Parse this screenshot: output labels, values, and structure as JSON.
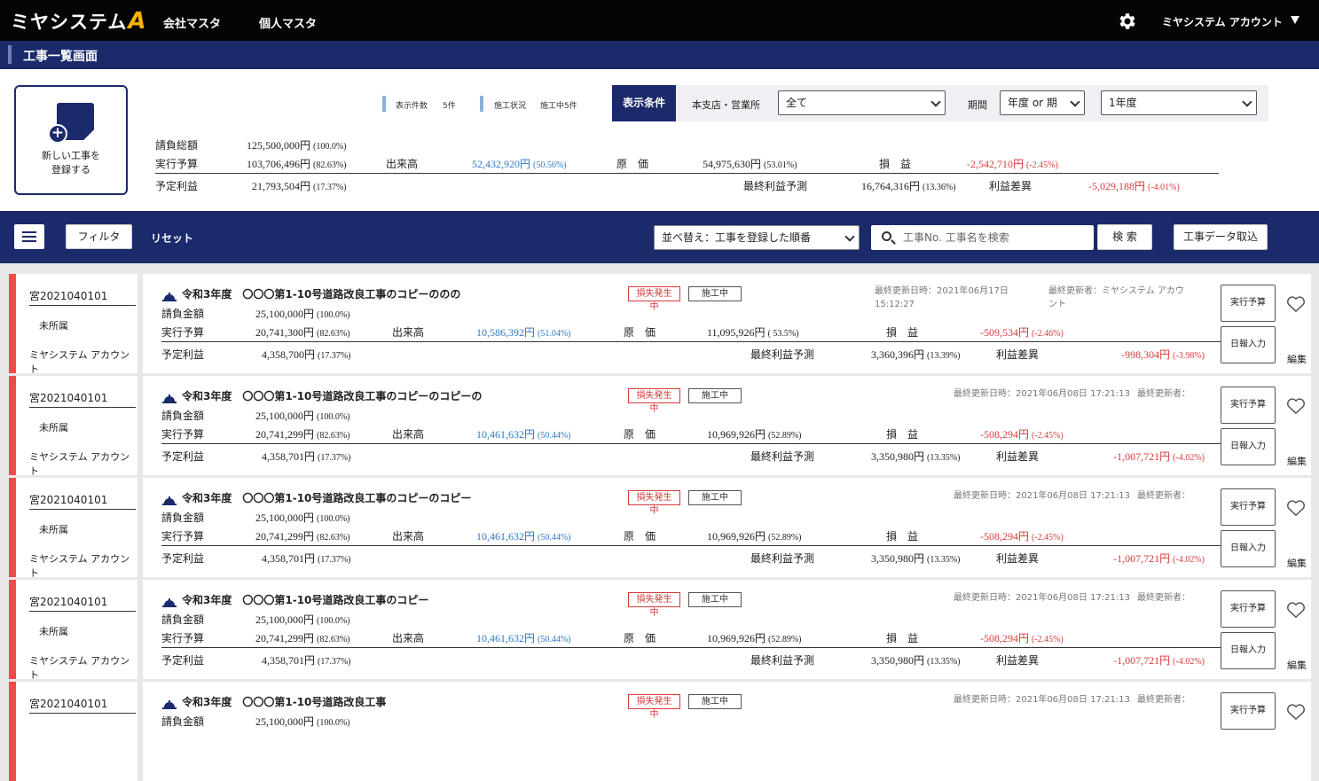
{
  "header": {
    "logo_text": "ミヤシステム",
    "logo_mark": "A",
    "nav": [
      "会社マスタ",
      "個人マスタ"
    ],
    "account": "ミヤシステム アカウント"
  },
  "page_title": "工事一覧画面",
  "new_button": {
    "line1": "新しい工事を",
    "line2": "登録する"
  },
  "stats": {
    "count_label": "表示件数",
    "count_value": "5件",
    "status_label": "施工状況",
    "status_value": "施工中5件"
  },
  "conditions": {
    "head": "表示条件",
    "branch_label": "本支店・営業所",
    "branch_value": "全て",
    "period_label": "期間",
    "period_type": "年度 or 期",
    "period_value": "1年度"
  },
  "summary": {
    "contract_label": "請負総額",
    "contract_value": "125,500,000円",
    "contract_pct": "(100.0%)",
    "budget_label": "実行予算",
    "budget_value": "103,706,496円",
    "budget_pct": "(82.63%)",
    "done_label": "出来高",
    "done_value": "52,432,920円",
    "done_pct": "(50.56%)",
    "cost_label": "原　価",
    "cost_value": "54,975,630円",
    "cost_pct": "(53.01%)",
    "pl_label": "損　益",
    "pl_value": "-2,542,710円",
    "pl_pct": "(-2.45%)",
    "profit_label": "予定利益",
    "profit_value": "21,793,504円",
    "profit_pct": "(17.37%)",
    "final_label": "最終利益予測",
    "final_value": "16,764,316円",
    "final_pct": "(13.36%)",
    "diff_label": "利益差異",
    "diff_value": "-5,029,188円",
    "diff_pct": "(-4.01%)"
  },
  "toolbar": {
    "filter": "フィルタ",
    "reset": "リセット",
    "sort": "並べ替え：工事を登録した順番",
    "search_placeholder": "工事No. 工事名を検索",
    "search_button": "検 索",
    "import_button": "工事データ取込"
  },
  "labels": {
    "contract": "請負金額",
    "budget": "実行予算",
    "done": "出来高",
    "cost": "原　価",
    "pl": "損　益",
    "profit": "予定利益",
    "final": "最終利益予測",
    "diff": "利益差異",
    "loss_badge": "損失発生中",
    "work_badge": "施工中",
    "budget_btn": "実行予算",
    "daily_btn": "日報入力",
    "edit": "編集"
  },
  "projects": [
    {
      "id": "宮2021040101",
      "dept": "未所属",
      "account": "ミヤシステム アカウント",
      "year": "令和3年度",
      "name": "〇〇〇第1-10号道路改良工事のコピーののの",
      "updated": "最終更新日時：2021年06月17日",
      "updated2": "15:12:27",
      "updater": "最終更新者：ミヤシステム アカウ",
      "updater2": "ント",
      "contract": "25,100,000円",
      "contract_pct": "(100.0%)",
      "budget": "20,741,300円",
      "budget_pct": "(82.63%)",
      "done": "10,586,392円",
      "done_pct": "(51.04%)",
      "cost": "11,095,926円",
      "cost_pct": "( 53.5%)",
      "pl": "-509,534円",
      "pl_pct": "(-2.46%)",
      "profit": "4,358,700円",
      "profit_pct": "(17.37%)",
      "final": "3,360,396円",
      "final_pct": "(13.39%)",
      "diff": "-998,304円",
      "diff_pct": "(-3.98%)"
    },
    {
      "id": "宮2021040101",
      "dept": "未所属",
      "account": "ミヤシステム アカウント",
      "year": "令和3年度",
      "name": "〇〇〇第1-10号道路改良工事のコピーのコピーの",
      "updated": "最終更新日時：2021年06月08日 17:21:13",
      "updated2": "",
      "updater": "最終更新者：",
      "updater2": "",
      "contract": "25,100,000円",
      "contract_pct": "(100.0%)",
      "budget": "20,741,299円",
      "budget_pct": "(82.63%)",
      "done": "10,461,632円",
      "done_pct": "(50.44%)",
      "cost": "10,969,926円",
      "cost_pct": "(52.89%)",
      "pl": "-508,294円",
      "pl_pct": "(-2.45%)",
      "profit": "4,358,701円",
      "profit_pct": "(17.37%)",
      "final": "3,350,980円",
      "final_pct": "(13.35%)",
      "diff": "-1,007,721円",
      "diff_pct": "(-4.02%)"
    },
    {
      "id": "宮2021040101",
      "dept": "未所属",
      "account": "ミヤシステム アカウント",
      "year": "令和3年度",
      "name": "〇〇〇第1-10号道路改良工事のコピーのコピー",
      "updated": "最終更新日時：2021年06月08日 17:21:13",
      "updated2": "",
      "updater": "最終更新者：",
      "updater2": "",
      "contract": "25,100,000円",
      "contract_pct": "(100.0%)",
      "budget": "20,741,299円",
      "budget_pct": "(82.63%)",
      "done": "10,461,632円",
      "done_pct": "(50.44%)",
      "cost": "10,969,926円",
      "cost_pct": "(52.89%)",
      "pl": "-508,294円",
      "pl_pct": "(-2.45%)",
      "profit": "4,358,701円",
      "profit_pct": "(17.37%)",
      "final": "3,350,980円",
      "final_pct": "(13.35%)",
      "diff": "-1,007,721円",
      "diff_pct": "(-4.02%)"
    },
    {
      "id": "宮2021040101",
      "dept": "未所属",
      "account": "ミヤシステム アカウント",
      "year": "令和3年度",
      "name": "〇〇〇第1-10号道路改良工事のコピー",
      "updated": "最終更新日時：2021年06月08日 17:21:13",
      "updated2": "",
      "updater": "最終更新者：",
      "updater2": "",
      "contract": "25,100,000円",
      "contract_pct": "(100.0%)",
      "budget": "20,741,299円",
      "budget_pct": "(82.63%)",
      "done": "10,461,632円",
      "done_pct": "(50.44%)",
      "cost": "10,969,926円",
      "cost_pct": "(52.89%)",
      "pl": "-508,294円",
      "pl_pct": "(-2.45%)",
      "profit": "4,358,701円",
      "profit_pct": "(17.37%)",
      "final": "3,350,980円",
      "final_pct": "(13.35%)",
      "diff": "-1,007,721円",
      "diff_pct": "(-4.02%)"
    },
    {
      "id": "宮2021040101",
      "dept": "",
      "account": "",
      "year": "令和3年度",
      "name": "〇〇〇第1-10号道路改良工事",
      "updated": "最終更新日時：2021年06月08日 17:21:13",
      "updated2": "",
      "updater": "最終更新者：",
      "updater2": "",
      "contract": "25,100,000円",
      "contract_pct": "(100.0%)"
    }
  ]
}
